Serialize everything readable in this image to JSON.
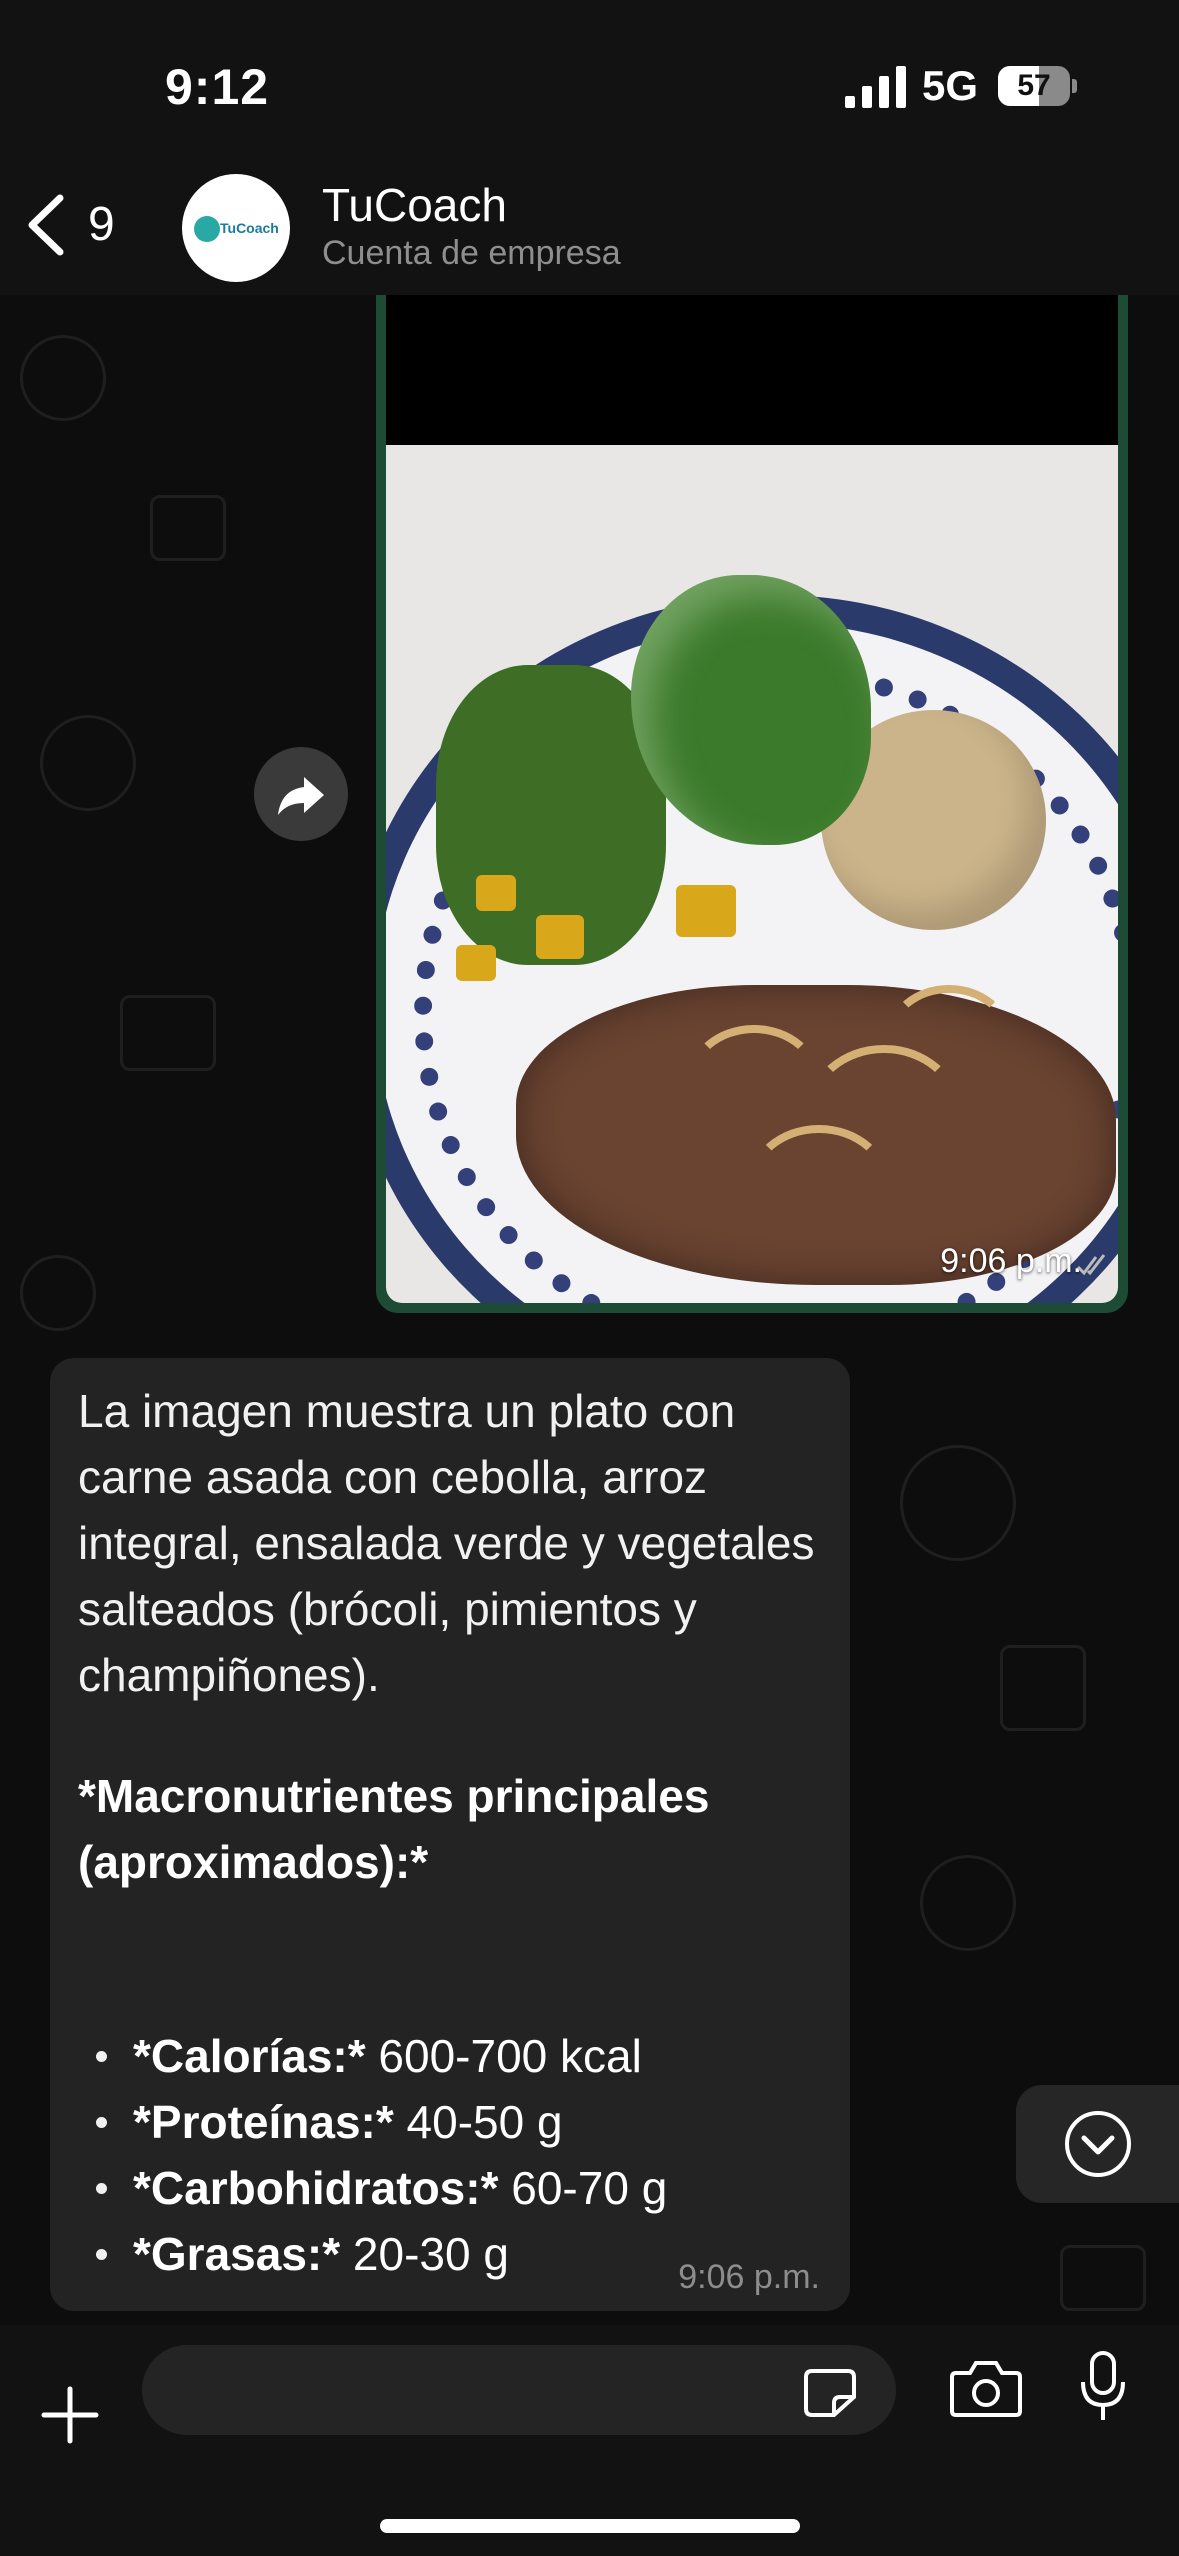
{
  "status_bar": {
    "time": "9:12",
    "network": "5G",
    "battery_level": "57",
    "battery_fraction": 0.57,
    "signal_icon": "signal-bars-icon"
  },
  "header": {
    "back_icon": "chevron-left-icon",
    "unread_count": "9",
    "contact_name": "TuCoach",
    "contact_subtitle": "Cuenta de empresa",
    "avatar_text": "TuCoach"
  },
  "messages": {
    "media": {
      "timestamp": "9:06 p.m.",
      "status_icon": "double-check-icon",
      "forward_icon": "forward-arrow-icon"
    },
    "text_message": {
      "paragraph": "La imagen muestra un plato con carne asada con cebolla, arroz integral, ensalada verde y vegetales salteados (brócoli, pimientos y champiñones).",
      "heading": "*Macronutrientes principales (aproximados):*",
      "items": [
        {
          "label": "*Calorías:*",
          "value": " 600-700 kcal"
        },
        {
          "label": "*Proteínas:*",
          "value": " 40-50 g"
        },
        {
          "label": "*Carbohidratos:*",
          "value": " 60-70 g"
        },
        {
          "label": "*Grasas:*",
          "value": " 20-30 g"
        }
      ],
      "timestamp": "9:06 p.m."
    }
  },
  "scroll_down_icon": "chevron-down-circle-icon",
  "input_bar": {
    "plus_icon": "plus-icon",
    "sticker_icon": "sticker-icon",
    "camera_icon": "camera-icon",
    "mic_icon": "microphone-icon",
    "placeholder": ""
  },
  "colors": {
    "outgoing_bubble": "#1e4b36",
    "incoming_bubble": "#232323",
    "background": "#0d0d0d"
  }
}
